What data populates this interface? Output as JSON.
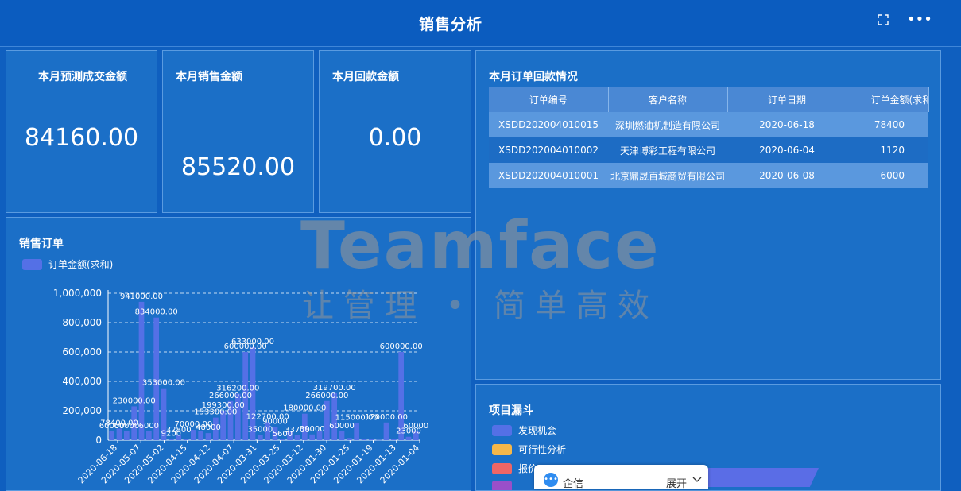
{
  "header": {
    "title": "销售分析",
    "fullscreen_icon": "fullscreen-icon",
    "more_icon": "more-dots-icon"
  },
  "kpis": [
    {
      "label": "本月预测成交金额",
      "value": "84160.00"
    },
    {
      "label": "本月销售金额",
      "value": "85520.00"
    },
    {
      "label": "本月回款金额",
      "value": "0.00"
    }
  ],
  "orders_panel": {
    "title": "本月订单回款情况",
    "columns": [
      "订单编号",
      "客户名称",
      "订单日期",
      "订单金额(求和"
    ],
    "rows": [
      [
        "XSDD202004010015",
        "深圳燃油机制造有限公司",
        "2020-06-18",
        "78400"
      ],
      [
        "XSDD202004010002",
        "天津博彩工程有限公司",
        "2020-06-04",
        "1120"
      ],
      [
        "XSDD202004010001",
        "北京鼎晟百城商贸有限公司",
        "2020-06-08",
        "6000"
      ]
    ]
  },
  "sales_panel": {
    "title": "销售订单",
    "legend": "订单金额(求和)"
  },
  "funnel_panel": {
    "title": "项目漏斗",
    "legend": [
      {
        "label": "发现机会",
        "color": "#5470e6"
      },
      {
        "label": "可行性分析",
        "color": "#f5b74a"
      },
      {
        "label": "报价",
        "color": "#ee6666"
      },
      {
        "label": "",
        "color": "#9a4fc9"
      }
    ]
  },
  "watermark": {
    "title": "Teamface",
    "subtitle": "让管理 • 简单高效"
  },
  "chat": {
    "label": "企信",
    "expand": "展开"
  },
  "chart_data": {
    "type": "bar",
    "series": [
      {
        "name": "订单金额(求和)",
        "values": [
          60000,
          78400,
          60000,
          230000,
          941000,
          60000,
          834000,
          353000,
          9200,
          32800,
          9200,
          70000,
          60000,
          48000,
          153300,
          199300,
          266000,
          316200,
          600000,
          633000,
          35000,
          122700,
          90000,
          5600,
          60000,
          33700,
          180000,
          39000,
          60000,
          266000,
          319700,
          60000,
          15000,
          115000,
          6000,
          6000,
          2000,
          120000,
          6000,
          600000,
          23000,
          60000
        ]
      }
    ],
    "x_ticks": [
      "2020-06-18",
      "2020-05-07",
      "2020-05-02",
      "2020-04-15",
      "2020-04-12",
      "2020-04-07",
      "2020-03-31",
      "2020-03-25",
      "2020-03-12",
      "2020-01-30",
      "2020-01-25",
      "2020-01-19",
      "2020-01-13",
      "2020-01-04"
    ],
    "y_ticks": [
      "0",
      "200,000",
      "400,000",
      "600,000",
      "800,000",
      "1,000,000"
    ],
    "ylim": [
      0,
      1000000
    ],
    "grid": true,
    "bar_color": "#5470e6",
    "data_labels": [
      {
        "text": "60000",
        "index": 0,
        "value": 60000
      },
      {
        "text": "78400.00",
        "index": 1,
        "value": 78400
      },
      {
        "text": "60000",
        "index": 2,
        "value": 60000
      },
      {
        "text": "230000.00",
        "index": 3,
        "value": 230000
      },
      {
        "text": "941000.00",
        "index": 4,
        "value": 941000
      },
      {
        "text": "6000",
        "index": 5,
        "value": 60000
      },
      {
        "text": "834000.00",
        "index": 6,
        "value": 834000
      },
      {
        "text": "353000.00",
        "index": 7,
        "value": 353000
      },
      {
        "text": "9200",
        "index": 8,
        "value": 9200
      },
      {
        "text": "32800",
        "index": 9,
        "value": 32800
      },
      {
        "text": "70000.00",
        "index": 11,
        "value": 70000
      },
      {
        "text": "48000",
        "index": 13,
        "value": 48000
      },
      {
        "text": "153300.00",
        "index": 14,
        "value": 153300
      },
      {
        "text": "199300.00",
        "index": 15,
        "value": 199300
      },
      {
        "text": "266000.00",
        "index": 16,
        "value": 266000
      },
      {
        "text": "316200.00",
        "index": 17,
        "value": 316200
      },
      {
        "text": "600000.00",
        "index": 18,
        "value": 600000
      },
      {
        "text": "633000.00",
        "index": 19,
        "value": 633000
      },
      {
        "text": "35000",
        "index": 20,
        "value": 35000
      },
      {
        "text": "122700.00",
        "index": 21,
        "value": 122700
      },
      {
        "text": "90000",
        "index": 22,
        "value": 90000
      },
      {
        "text": "5600",
        "index": 23,
        "value": 5600
      },
      {
        "text": "33700",
        "index": 25,
        "value": 33700
      },
      {
        "text": "180000.00",
        "index": 26,
        "value": 180000
      },
      {
        "text": "39000",
        "index": 27,
        "value": 39000
      },
      {
        "text": "266000.00",
        "index": 29,
        "value": 266000
      },
      {
        "text": "319700.00",
        "index": 30,
        "value": 319700
      },
      {
        "text": "60000",
        "index": 31,
        "value": 60000
      },
      {
        "text": "115000.00",
        "index": 33,
        "value": 115000
      },
      {
        "text": "120000.00",
        "index": 37,
        "value": 120000
      },
      {
        "text": "600000.00",
        "index": 39,
        "value": 600000
      },
      {
        "text": "23000",
        "index": 40,
        "value": 23000
      },
      {
        "text": "60000",
        "index": 41,
        "value": 60000
      }
    ]
  }
}
